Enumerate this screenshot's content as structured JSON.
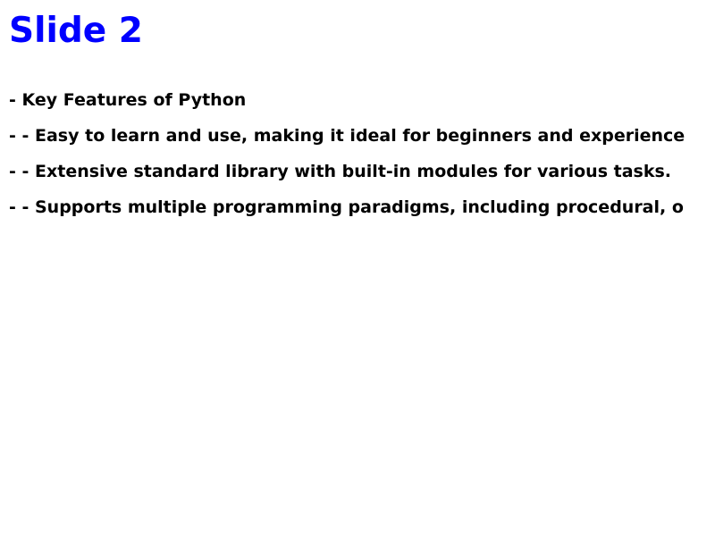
{
  "slide": {
    "title": "Slide 2",
    "title_color": "#0000ff",
    "lines": [
      "- Key Features of Python",
      "- - Easy to learn and use, making it ideal for beginners and experience",
      "- - Extensive standard library with built-in modules for various tasks.",
      "- - Supports multiple programming paradigms, including procedural, o"
    ]
  }
}
